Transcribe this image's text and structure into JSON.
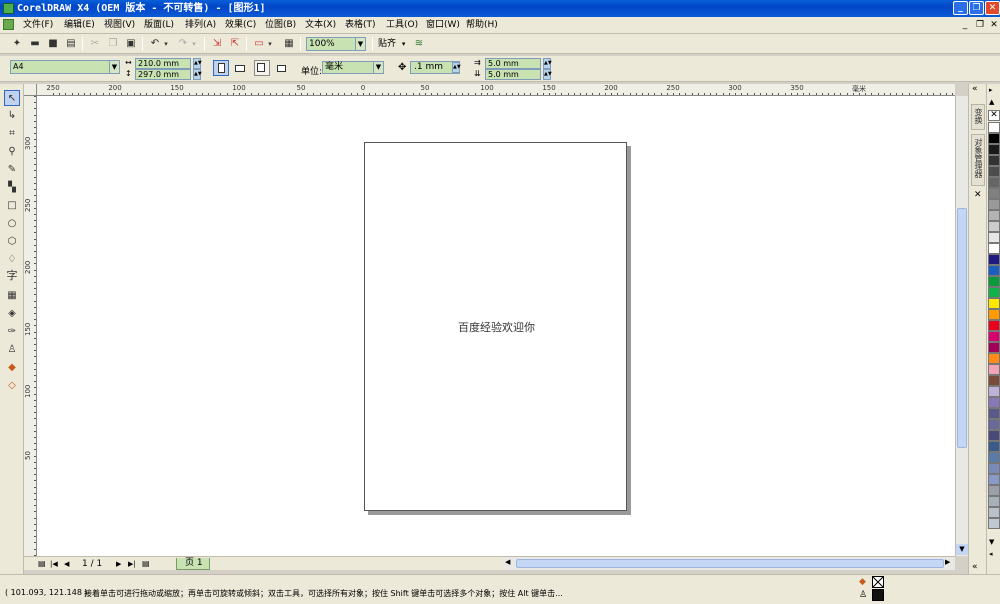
{
  "window": {
    "title": "CorelDRAW X4 (OEM 版本 - 不可转售) - [图形1]",
    "controls": [
      "_",
      "❐",
      "✕"
    ]
  },
  "menu": {
    "items": [
      "文件(F)",
      "编辑(E)",
      "视图(V)",
      "版面(L)",
      "排列(A)",
      "效果(C)",
      "位图(B)",
      "文本(X)",
      "表格(T)",
      "工具(O)",
      "窗口(W)",
      "帮助(H)"
    ],
    "mdi_controls": [
      "_",
      "❐",
      "✕"
    ]
  },
  "standard_toolbar": {
    "zoom": "100%",
    "snap_label": "贴齐"
  },
  "property_bar": {
    "page_size": "A4",
    "width": "210.0 mm",
    "height": "297.0 mm",
    "unit_label": "单位:",
    "unit": "毫米",
    "nudge": ".1 mm",
    "dup_x": "5.0 mm",
    "dup_y": "5.0 mm"
  },
  "ruler": {
    "h_labels": [
      "250",
      "200",
      "150",
      "100",
      "50",
      "0",
      "50",
      "100",
      "150",
      "200",
      "250",
      "300",
      "350",
      "毫米"
    ],
    "v_labels": [
      "300",
      "250",
      "200",
      "150",
      "100",
      "50"
    ]
  },
  "page": {
    "text": "百度经验欢迎你"
  },
  "page_nav": {
    "counter": "1 / 1",
    "tab": "页 1"
  },
  "status": {
    "coords": "( 101.093, 121.148 )",
    "hint": "接着单击可进行拖动或缩放；再单击可旋转或倾斜；双击工具，可选择所有对象；按住 Shift 键单击可选择多个对象；按住 Alt 键单击..."
  },
  "docker_tabs": [
    "变换",
    "对象管理器"
  ],
  "palette": [
    "#ffffff",
    "#000000",
    "#1a1a1a",
    "#333333",
    "#4d4d4d",
    "#666666",
    "#808080",
    "#999999",
    "#b3b3b3",
    "#cccccc",
    "#e6e6e6",
    "#ffffff",
    "#1e1a80",
    "#1a5fbf",
    "#0a9a3a",
    "#12b24a",
    "#ffe800",
    "#ff9a00",
    "#e8001c",
    "#d6006e",
    "#a3005a",
    "#ff8a1a",
    "#f2a4b4",
    "#7a4a3a",
    "#bfb0d8",
    "#8878b8",
    "#5a5a8a",
    "#6a6a9a",
    "#4a4a7a",
    "#3a5a8a",
    "#5a7aa8",
    "#7a8ab8",
    "#8a9ac8",
    "#9aa0a8",
    "#a8b0b8",
    "#b8c0c8",
    "#c0c8d0"
  ]
}
